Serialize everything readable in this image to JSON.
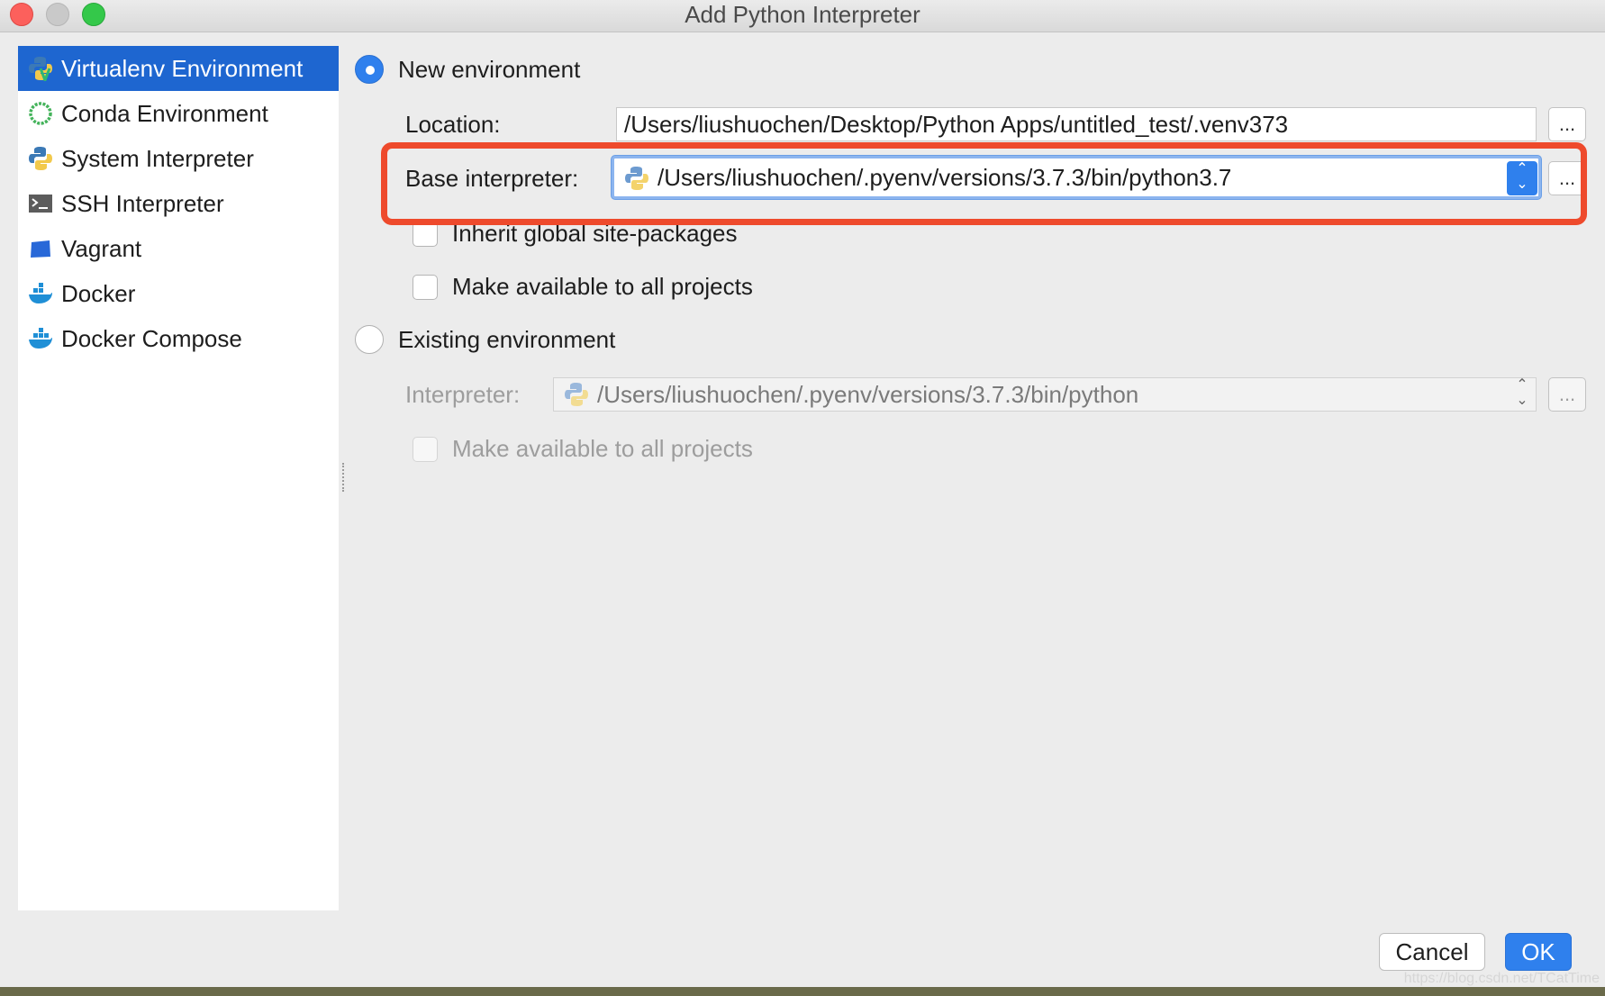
{
  "window": {
    "title": "Add Python Interpreter"
  },
  "sidebar": {
    "items": [
      {
        "label": "Virtualenv Environment",
        "icon": "virtualenv-icon",
        "selected": true
      },
      {
        "label": "Conda Environment",
        "icon": "conda-icon",
        "selected": false
      },
      {
        "label": "System Interpreter",
        "icon": "python-icon",
        "selected": false
      },
      {
        "label": "SSH Interpreter",
        "icon": "terminal-icon",
        "selected": false
      },
      {
        "label": "Vagrant",
        "icon": "vagrant-icon",
        "selected": false
      },
      {
        "label": "Docker",
        "icon": "docker-icon",
        "selected": false
      },
      {
        "label": "Docker Compose",
        "icon": "docker-compose-icon",
        "selected": false
      }
    ]
  },
  "new_env": {
    "radio_label": "New environment",
    "selected": true,
    "location_label": "Location:",
    "location_value": "/Users/liushuochen/Desktop/Python Apps/untitled_test/.venv373",
    "base_label": "Base interpreter:",
    "base_value": "/Users/liushuochen/.pyenv/versions/3.7.3/bin/python3.7",
    "inherit_label": "Inherit global site-packages",
    "make_available_label": "Make available to all projects",
    "browse_label": "..."
  },
  "existing_env": {
    "radio_label": "Existing environment",
    "selected": false,
    "interpreter_label": "Interpreter:",
    "interpreter_value": "/Users/liushuochen/.pyenv/versions/3.7.3/bin/python",
    "make_available_label": "Make available to all projects",
    "browse_label": "..."
  },
  "footer": {
    "cancel_label": "Cancel",
    "ok_label": "OK"
  },
  "watermark": "https://blog.csdn.net/TCatTime",
  "colors": {
    "accent": "#2f80ed",
    "selection": "#1e66d0",
    "highlight": "#ee4a2c"
  }
}
